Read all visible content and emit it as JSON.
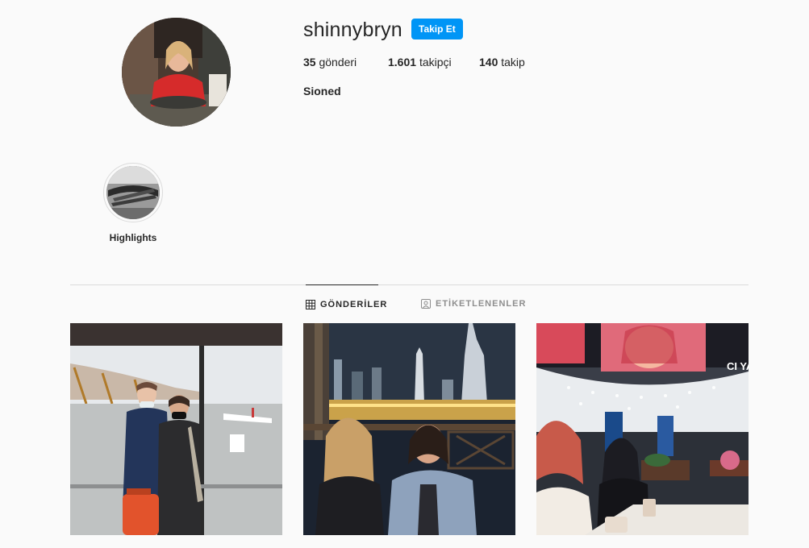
{
  "profile": {
    "username": "shinnybryn",
    "follow_label": "Takip Et",
    "posts_count": "35",
    "posts_label": "gönderi",
    "followers_count": "1.601",
    "followers_label": "takipçi",
    "following_count": "140",
    "following_label": "takip",
    "full_name": "Sioned"
  },
  "highlights": [
    {
      "label": "Highlights"
    }
  ],
  "tabs": [
    {
      "label": "GÖNDERİLER",
      "icon": "grid-icon",
      "active": true
    },
    {
      "label": "ETİKETLENENLER",
      "icon": "tag-icon",
      "active": false
    }
  ],
  "posts": [
    {
      "subject": "airport-window-photo"
    },
    {
      "subject": "night-city-photo"
    },
    {
      "subject": "mall-photo",
      "visible_sign_text": "CI YAM"
    }
  ],
  "colors": {
    "accent": "#0095f6",
    "background": "#fafafa",
    "divider": "#dbdbdb",
    "muted": "#8e8e8e",
    "text": "#262626"
  }
}
